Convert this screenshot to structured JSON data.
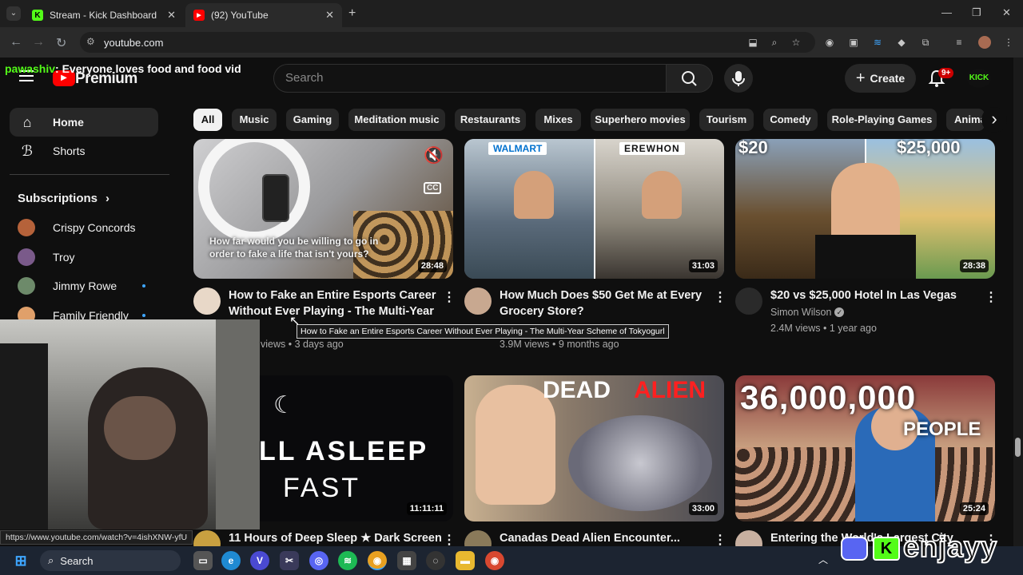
{
  "browser": {
    "tabs": [
      {
        "title": "Stream - Kick Dashboard",
        "active": false
      },
      {
        "title": "(92) YouTube",
        "active": true
      }
    ],
    "url": "youtube.com"
  },
  "overlay": {
    "chat_user": "pawashiv",
    "chat_message": ": Everyone loves food and food vid",
    "brand": "enjayy"
  },
  "header": {
    "logo_text": "Premium",
    "search_placeholder": "Search",
    "create_label": "Create",
    "notif_count": "9+",
    "kick_badge": "KICK"
  },
  "sidebar": {
    "items": [
      {
        "label": "Home"
      },
      {
        "label": "Shorts"
      }
    ],
    "subscriptions_title": "Subscriptions",
    "subscriptions": [
      {
        "name": "Crispy Concords",
        "new": false
      },
      {
        "name": "Troy",
        "new": false
      },
      {
        "name": "Jimmy Rowe",
        "new": true
      },
      {
        "name": "Family Friendly",
        "new": true
      }
    ]
  },
  "chips": [
    "All",
    "Music",
    "Gaming",
    "Meditation music",
    "Restaurants",
    "Mixes",
    "Superhero movies",
    "Tourism",
    "Comedy",
    "Role-Playing Games",
    "Anima"
  ],
  "videos": [
    {
      "title_line1": "How to Fake an Entire Esports Career",
      "title_line2": "Without Ever Playing - The Multi-Year ...",
      "meta": "views • 3 days ago",
      "duration": "28:48",
      "thumb_caption": "How far would you be willing to go in order to fake a life that isn't yours?",
      "tooltip": "How to Fake an Entire Esports Career Without Ever Playing - The Multi-Year Scheme of Tokyogurl"
    },
    {
      "title_line1": "How Much Does $50 Get Me at Every",
      "title_line2": "Grocery Store?",
      "meta": "3.9M views • 9 months ago",
      "duration": "31:03",
      "thumb_left": "WALMART",
      "thumb_right": "EREWHON"
    },
    {
      "title_line1": "$20 vs $25,000 Hotel In Las Vegas",
      "channel": "Simon Wilson",
      "meta": "2.4M views • 1 year ago",
      "duration": "28:38",
      "thumb_left": "$20",
      "thumb_right": "$25,000"
    },
    {
      "title_line1": "11 Hours of Deep Sleep ★ Dark Screen",
      "duration": "11:11:11",
      "thumb_line1": "LL ASLEEP",
      "thumb_line2": "FAST"
    },
    {
      "title_line1": "Canadas Dead Alien Encounter...",
      "duration": "33:00",
      "thumb_word1": "DEAD",
      "thumb_word2": "ALIEN"
    },
    {
      "title_line1": "Entering the World's Largest City",
      "duration": "25:24",
      "thumb_line1": "36,000,000",
      "thumb_line2": "PEOPLE"
    }
  ],
  "status_url": "https://www.youtube.com/watch?v=4ishXNW-yfU",
  "taskbar": {
    "search_label": "Search"
  },
  "colors": {
    "accent_red": "#ff0000",
    "kick_green": "#53fc18",
    "link_blue": "#3ea6ff"
  }
}
